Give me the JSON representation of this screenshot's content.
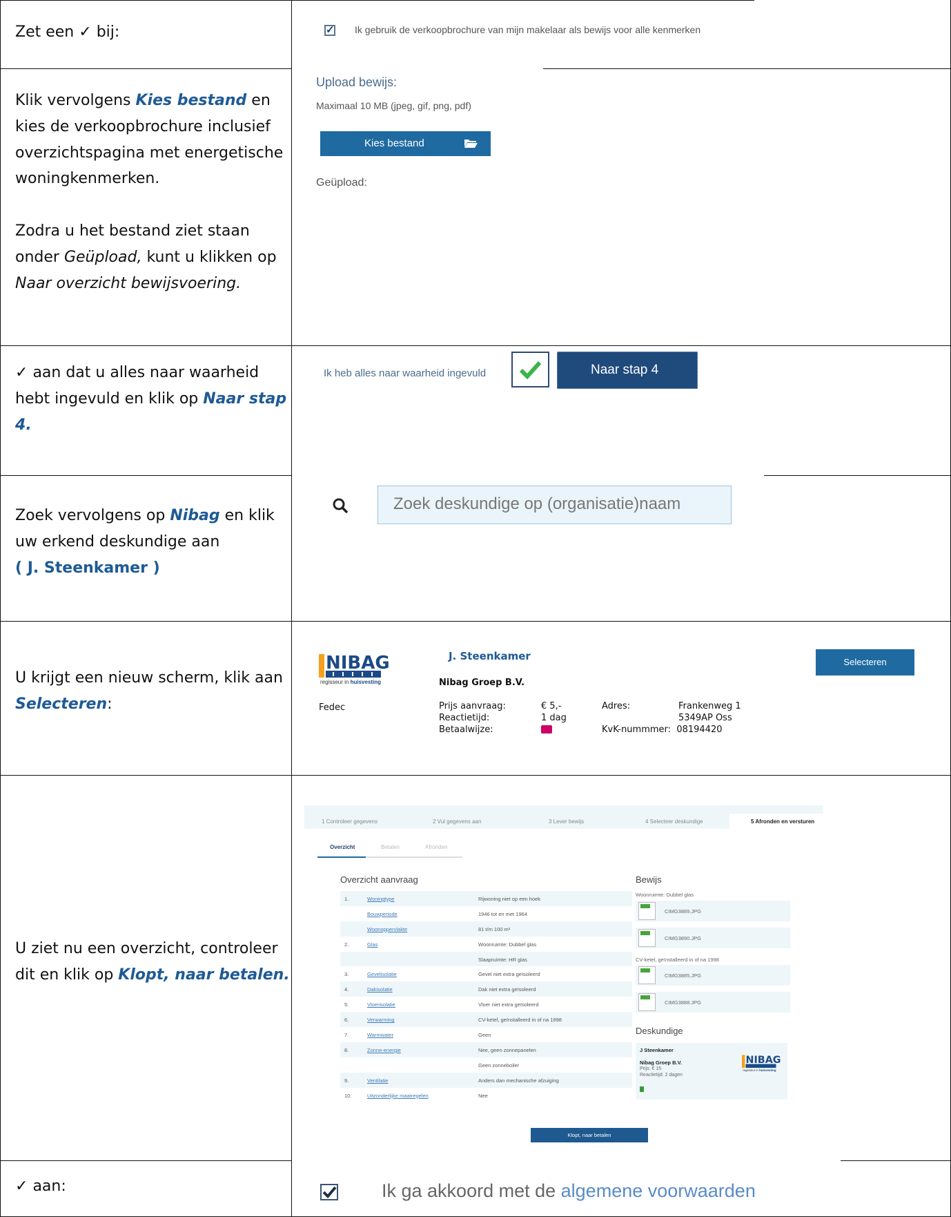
{
  "rows": [
    {
      "instruction": {
        "pre": "Zet een",
        "post": "bij:"
      },
      "checkbox_label": "Ik gebruik de verkoopbrochure van mijn makelaar als bewijs voor alle kenmerken"
    },
    {
      "instruction": {
        "p1": "Klik vervolgens",
        "p1_hl": "Kies bestand",
        "p1_rest": "en kies de verkoopbrochure inclusief overzichtspagina met energetische woningkenmerken.",
        "p2a": "Zodra u het bestand ziet staan onder",
        "p2_em": "Geüpload,",
        "p2b": "kunt u klikken op",
        "p2_em2": "Naar overzicht bewijsvoering."
      },
      "upload_title": "Upload bewijs:",
      "upload_sub": "Maximaal 10 MB (jpeg, gif, png, pdf)",
      "upload_button": "Kies bestand",
      "uploaded_label": "Geüpload:"
    },
    {
      "instruction": {
        "pre": "aan dat u alles naar waarheid hebt ingevuld en klik op",
        "hl": "Naar stap 4",
        "post": "."
      },
      "confirm_text": "Ik heb alles naar waarheid ingevuld",
      "next_button": "Naar stap 4"
    },
    {
      "instruction": {
        "pre": "Zoek vervolgens op",
        "hl": "Nibag",
        "mid": "en klik uw erkend deskundige aan",
        "hl2": "( J. Steenkamer )"
      },
      "search_placeholder": "Zoek deskundige op (organisatie)naam"
    },
    {
      "instruction": {
        "pre": "U krijgt een nieuw scherm, klik aan",
        "hl": "Selecteren",
        "post": ":"
      },
      "logo_word": "NIBAG",
      "logo_tag_pre": "regisseur in",
      "logo_tag_bold": "huisvesting",
      "org_type": "Fedec",
      "expert_name": "J. Steenkamer",
      "expert_org": "Nibag Groep B.V.",
      "labels": [
        "Prijs aanvraag:",
        "Reactietijd:",
        "Betaalwijze:"
      ],
      "values": [
        "€ 5,-",
        "1 dag"
      ],
      "address_label": "Adres:",
      "address": [
        "Frankenweg 1",
        "5349AP Oss"
      ],
      "kvk_label": "KvK-nummmer:",
      "kvk": "08194420",
      "select_button": "Selecteren"
    },
    {
      "instruction": {
        "pre": "U ziet nu een overzicht, controleer dit en klik op",
        "hl": "Klopt, naar betalen",
        "post": "."
      },
      "steps": [
        "1 Controleer gegevens",
        "2 Vul gegevens aan",
        "3 Lever bewijs",
        "4 Selecteer deskundige",
        "5 Afronden en versturen"
      ],
      "subtabs": [
        "Overzicht",
        "Betalen",
        "Afronden"
      ],
      "overview_title": "Overzicht aanvraag",
      "overview_rows": [
        {
          "num": "1.",
          "link": "Woningtype",
          "val": "Rijwoning niet op een hoek"
        },
        {
          "num": "",
          "link": "Bouwperiode",
          "val": "1946 tot en met 1964"
        },
        {
          "num": "",
          "link": "Woonoppervlakte",
          "val": "81 t/m 100 m²"
        },
        {
          "num": "2.",
          "link": "Glas",
          "val": "Woonruimte: Dubbel glas"
        },
        {
          "num": "",
          "link": "",
          "val": "Slaapruimte: HR glas"
        },
        {
          "num": "3.",
          "link": "Gevelisolatie",
          "val": "Gevel niet extra geïsoleerd"
        },
        {
          "num": "4.",
          "link": "Dakisolatie",
          "val": "Dak niet extra geïsoleerd"
        },
        {
          "num": "5.",
          "link": "Vloerisolatie",
          "val": "Vloer niet extra geïsoleerd"
        },
        {
          "num": "6.",
          "link": "Verwarming",
          "val": "CV-ketel, geïnstalleerd in of na 1998"
        },
        {
          "num": "7.",
          "link": "Warmwater",
          "val": "Geen"
        },
        {
          "num": "8.",
          "link": "Zonne-energie",
          "val": "Nee, geen zonnepanelen"
        },
        {
          "num": "",
          "link": "",
          "val": "Geen zonneboiler"
        },
        {
          "num": "9.",
          "link": "Ventilatie",
          "val": "Anders dan mechanische afzuiging"
        },
        {
          "num": "10.",
          "link": "Uitzonderlijke maatregelen",
          "val": "Nee"
        }
      ],
      "bewijs_title": "Bewijs",
      "bewijs_groups": [
        {
          "label": "Woonruimte: Dubbel glas",
          "files": [
            "CIMG3889.JPG",
            "CIMG3890.JPG"
          ]
        },
        {
          "label": "CV-ketel, geïnstalleerd in of na 1998",
          "files": [
            "CIMG3885.JPG",
            "CIMG3888.JPG"
          ]
        }
      ],
      "file_badge": "JPG",
      "deskundige_title": "Deskundige",
      "desk_name": "J Steenkamer",
      "desk_org": "Nibag Groep B.V.",
      "desk_price": "Prijs: € 15",
      "desk_time": "Reactietijd: 2 dagen",
      "confirm_button": "Klopt, naar betalen"
    },
    {
      "instruction": {
        "post": "aan:"
      },
      "agree_pre": "Ik ga akkoord met de",
      "agree_link": "algemene voorwaarden"
    }
  ]
}
